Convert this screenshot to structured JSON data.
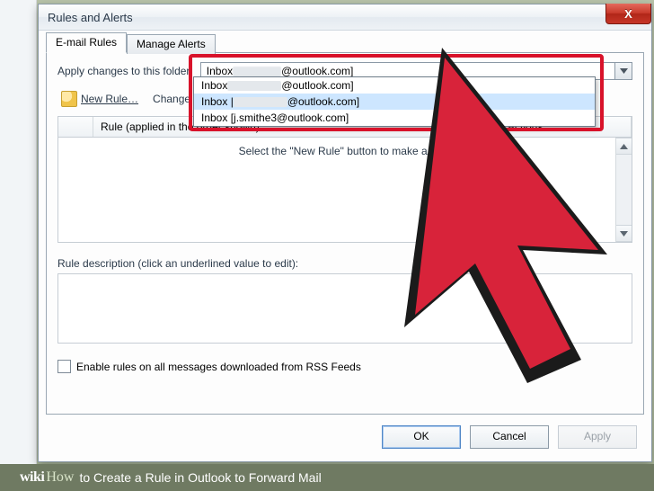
{
  "caption": {
    "logo1": "wiki",
    "logo2": "How",
    "text": " to Create a Rule in Outlook to Forward Mail"
  },
  "window": {
    "title": "Rules and Alerts",
    "close_glyph": "X"
  },
  "tabs": {
    "email": "E-mail Rules",
    "alerts": "Manage Alerts"
  },
  "folder": {
    "label": "Apply changes to this folder:",
    "selected_prefix": "Inbox ",
    "selected_suffix": "@outlook.com]"
  },
  "toolbar": {
    "new_rule": "New Rule…",
    "change_rule": "Change Rul"
  },
  "list": {
    "col_rule": "Rule (applied in the order shown)",
    "col_actions": "Actions",
    "empty": "Select the \"New Rule\" button to make a rule."
  },
  "description": {
    "label": "Rule description (click an underlined value to edit):"
  },
  "rss": {
    "label": "Enable rules on all messages downloaded from RSS Feeds"
  },
  "buttons": {
    "ok": "OK",
    "cancel": "Cancel",
    "apply": "Apply"
  },
  "dropdown": {
    "items": [
      {
        "prefix": "Inbox ",
        "blur": true,
        "suffix": "@outlook.com]",
        "selected": false
      },
      {
        "prefix": "Inbox |",
        "blur": true,
        "suffix": "@outlook.com]",
        "selected": true
      },
      {
        "prefix": "Inbox [j.smithe3@outlook.com]",
        "blur": false,
        "suffix": "",
        "selected": false
      }
    ]
  }
}
